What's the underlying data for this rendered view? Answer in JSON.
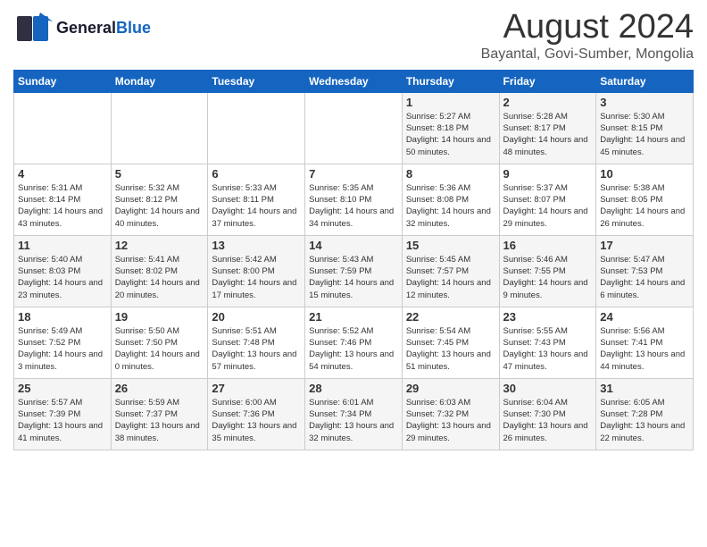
{
  "logo": {
    "general": "General",
    "blue": "Blue"
  },
  "calendar": {
    "title": "August 2024",
    "subtitle": "Bayantal, Govi-Sumber, Mongolia",
    "weekdays": [
      "Sunday",
      "Monday",
      "Tuesday",
      "Wednesday",
      "Thursday",
      "Friday",
      "Saturday"
    ],
    "weeks": [
      [
        {
          "day": "",
          "sunrise": "",
          "sunset": "",
          "daylight": ""
        },
        {
          "day": "",
          "sunrise": "",
          "sunset": "",
          "daylight": ""
        },
        {
          "day": "",
          "sunrise": "",
          "sunset": "",
          "daylight": ""
        },
        {
          "day": "",
          "sunrise": "",
          "sunset": "",
          "daylight": ""
        },
        {
          "day": "1",
          "sunrise": "Sunrise: 5:27 AM",
          "sunset": "Sunset: 8:18 PM",
          "daylight": "Daylight: 14 hours and 50 minutes."
        },
        {
          "day": "2",
          "sunrise": "Sunrise: 5:28 AM",
          "sunset": "Sunset: 8:17 PM",
          "daylight": "Daylight: 14 hours and 48 minutes."
        },
        {
          "day": "3",
          "sunrise": "Sunrise: 5:30 AM",
          "sunset": "Sunset: 8:15 PM",
          "daylight": "Daylight: 14 hours and 45 minutes."
        }
      ],
      [
        {
          "day": "4",
          "sunrise": "Sunrise: 5:31 AM",
          "sunset": "Sunset: 8:14 PM",
          "daylight": "Daylight: 14 hours and 43 minutes."
        },
        {
          "day": "5",
          "sunrise": "Sunrise: 5:32 AM",
          "sunset": "Sunset: 8:12 PM",
          "daylight": "Daylight: 14 hours and 40 minutes."
        },
        {
          "day": "6",
          "sunrise": "Sunrise: 5:33 AM",
          "sunset": "Sunset: 8:11 PM",
          "daylight": "Daylight: 14 hours and 37 minutes."
        },
        {
          "day": "7",
          "sunrise": "Sunrise: 5:35 AM",
          "sunset": "Sunset: 8:10 PM",
          "daylight": "Daylight: 14 hours and 34 minutes."
        },
        {
          "day": "8",
          "sunrise": "Sunrise: 5:36 AM",
          "sunset": "Sunset: 8:08 PM",
          "daylight": "Daylight: 14 hours and 32 minutes."
        },
        {
          "day": "9",
          "sunrise": "Sunrise: 5:37 AM",
          "sunset": "Sunset: 8:07 PM",
          "daylight": "Daylight: 14 hours and 29 minutes."
        },
        {
          "day": "10",
          "sunrise": "Sunrise: 5:38 AM",
          "sunset": "Sunset: 8:05 PM",
          "daylight": "Daylight: 14 hours and 26 minutes."
        }
      ],
      [
        {
          "day": "11",
          "sunrise": "Sunrise: 5:40 AM",
          "sunset": "Sunset: 8:03 PM",
          "daylight": "Daylight: 14 hours and 23 minutes."
        },
        {
          "day": "12",
          "sunrise": "Sunrise: 5:41 AM",
          "sunset": "Sunset: 8:02 PM",
          "daylight": "Daylight: 14 hours and 20 minutes."
        },
        {
          "day": "13",
          "sunrise": "Sunrise: 5:42 AM",
          "sunset": "Sunset: 8:00 PM",
          "daylight": "Daylight: 14 hours and 17 minutes."
        },
        {
          "day": "14",
          "sunrise": "Sunrise: 5:43 AM",
          "sunset": "Sunset: 7:59 PM",
          "daylight": "Daylight: 14 hours and 15 minutes."
        },
        {
          "day": "15",
          "sunrise": "Sunrise: 5:45 AM",
          "sunset": "Sunset: 7:57 PM",
          "daylight": "Daylight: 14 hours and 12 minutes."
        },
        {
          "day": "16",
          "sunrise": "Sunrise: 5:46 AM",
          "sunset": "Sunset: 7:55 PM",
          "daylight": "Daylight: 14 hours and 9 minutes."
        },
        {
          "day": "17",
          "sunrise": "Sunrise: 5:47 AM",
          "sunset": "Sunset: 7:53 PM",
          "daylight": "Daylight: 14 hours and 6 minutes."
        }
      ],
      [
        {
          "day": "18",
          "sunrise": "Sunrise: 5:49 AM",
          "sunset": "Sunset: 7:52 PM",
          "daylight": "Daylight: 14 hours and 3 minutes."
        },
        {
          "day": "19",
          "sunrise": "Sunrise: 5:50 AM",
          "sunset": "Sunset: 7:50 PM",
          "daylight": "Daylight: 14 hours and 0 minutes."
        },
        {
          "day": "20",
          "sunrise": "Sunrise: 5:51 AM",
          "sunset": "Sunset: 7:48 PM",
          "daylight": "Daylight: 13 hours and 57 minutes."
        },
        {
          "day": "21",
          "sunrise": "Sunrise: 5:52 AM",
          "sunset": "Sunset: 7:46 PM",
          "daylight": "Daylight: 13 hours and 54 minutes."
        },
        {
          "day": "22",
          "sunrise": "Sunrise: 5:54 AM",
          "sunset": "Sunset: 7:45 PM",
          "daylight": "Daylight: 13 hours and 51 minutes."
        },
        {
          "day": "23",
          "sunrise": "Sunrise: 5:55 AM",
          "sunset": "Sunset: 7:43 PM",
          "daylight": "Daylight: 13 hours and 47 minutes."
        },
        {
          "day": "24",
          "sunrise": "Sunrise: 5:56 AM",
          "sunset": "Sunset: 7:41 PM",
          "daylight": "Daylight: 13 hours and 44 minutes."
        }
      ],
      [
        {
          "day": "25",
          "sunrise": "Sunrise: 5:57 AM",
          "sunset": "Sunset: 7:39 PM",
          "daylight": "Daylight: 13 hours and 41 minutes."
        },
        {
          "day": "26",
          "sunrise": "Sunrise: 5:59 AM",
          "sunset": "Sunset: 7:37 PM",
          "daylight": "Daylight: 13 hours and 38 minutes."
        },
        {
          "day": "27",
          "sunrise": "Sunrise: 6:00 AM",
          "sunset": "Sunset: 7:36 PM",
          "daylight": "Daylight: 13 hours and 35 minutes."
        },
        {
          "day": "28",
          "sunrise": "Sunrise: 6:01 AM",
          "sunset": "Sunset: 7:34 PM",
          "daylight": "Daylight: 13 hours and 32 minutes."
        },
        {
          "day": "29",
          "sunrise": "Sunrise: 6:03 AM",
          "sunset": "Sunset: 7:32 PM",
          "daylight": "Daylight: 13 hours and 29 minutes."
        },
        {
          "day": "30",
          "sunrise": "Sunrise: 6:04 AM",
          "sunset": "Sunset: 7:30 PM",
          "daylight": "Daylight: 13 hours and 26 minutes."
        },
        {
          "day": "31",
          "sunrise": "Sunrise: 6:05 AM",
          "sunset": "Sunset: 7:28 PM",
          "daylight": "Daylight: 13 hours and 22 minutes."
        }
      ]
    ]
  }
}
